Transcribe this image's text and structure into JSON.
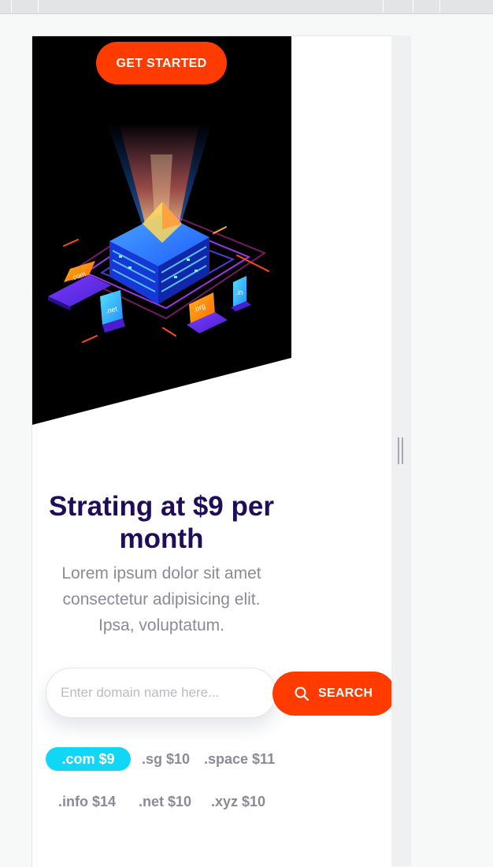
{
  "hero": {
    "cta_label": "GET STARTED",
    "illustration_tags": [
      ".com",
      ".net",
      ".org",
      ".in"
    ]
  },
  "pricing": {
    "headline": "Strating at $9 per month",
    "lead": "Lorem ipsum dolor sit amet consectetur adipisicing elit. Ipsa, voluptatum."
  },
  "search": {
    "placeholder": "Enter domain name here...",
    "button_label": "SEARCH",
    "icon": "search-icon"
  },
  "tlds": [
    {
      "label": ".com $9",
      "active": true
    },
    {
      "label": ".sg $10",
      "active": false
    },
    {
      "label": ".space $11",
      "active": false
    },
    {
      "label": ".info $14",
      "active": false
    },
    {
      "label": ".net $10",
      "active": false
    },
    {
      "label": ".xyz $10",
      "active": false
    }
  ],
  "colors": {
    "accent": "#ff3b00",
    "heading": "#1f0e57",
    "tld_active": "#12d6f5",
    "hero_bg": "#000000"
  }
}
